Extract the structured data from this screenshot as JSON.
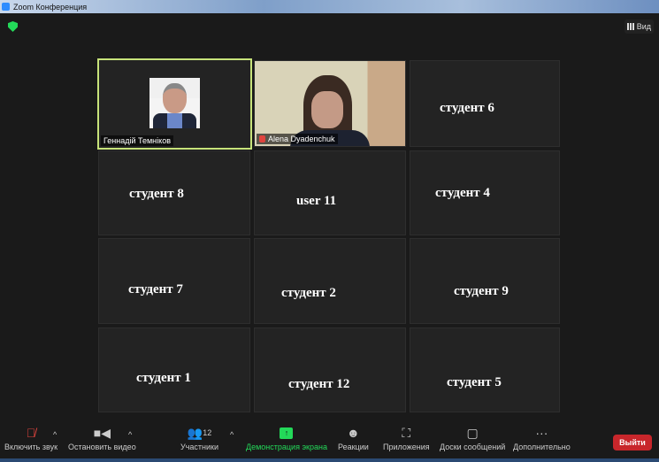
{
  "window": {
    "title": "Zoom Конференция"
  },
  "header": {
    "view_label": "Вид",
    "security_color": "#23d959"
  },
  "participants": [
    {
      "name": "Геннадій Темніков",
      "active_speaker": true,
      "video": true
    },
    {
      "name": "Alena Dyadenchuk",
      "muted": true,
      "video": true
    },
    {
      "name": "студент 6"
    },
    {
      "name": "студент 8"
    },
    {
      "name": "user 11"
    },
    {
      "name": "студент 4"
    },
    {
      "name": "студент 7"
    },
    {
      "name": "студент 2"
    },
    {
      "name": "студент 9"
    },
    {
      "name": "студент 1"
    },
    {
      "name": "студент 12"
    },
    {
      "name": "студент 5"
    }
  ],
  "toolbar": {
    "unmute": "Включить звук",
    "stop_video": "Остановить видео",
    "participants": "Участники",
    "participants_count": "12",
    "share": "Демонстрация экрана",
    "reactions": "Реакции",
    "apps": "Приложения",
    "whiteboards": "Доски сообщений",
    "more": "Дополнительно",
    "leave": "Выйти"
  },
  "colors": {
    "accent_green": "#23d959",
    "leave_red": "#c8262b",
    "active_border": "#c7e37a"
  }
}
